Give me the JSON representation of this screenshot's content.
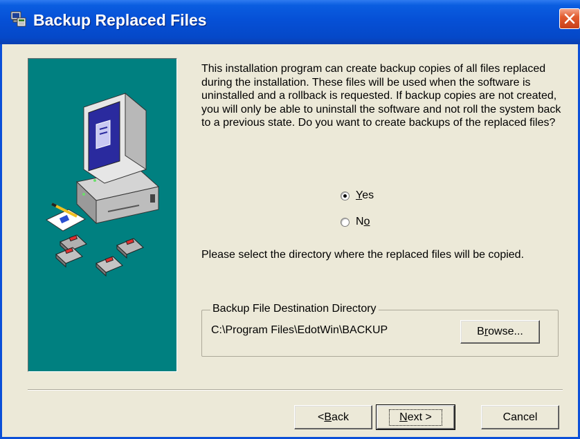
{
  "window": {
    "title": "Backup Replaced Files",
    "close_icon": "close-icon",
    "title_icon": "installer-icon",
    "accent_color": "#0a4fd8",
    "close_color": "#e25c30"
  },
  "side_panel": {
    "background": "#008080",
    "illustration": "computer-with-floppy-disks"
  },
  "intro_text": "This installation program can create backup copies of all files replaced during the installation. These files will be used when the software is uninstalled and a rollback is requested.  If backup copies are not created, you will only be able to uninstall the software and not roll the system back to a previous state. Do you want to create backups of the replaced files?",
  "options": {
    "yes": {
      "pre": "",
      "key": "Y",
      "post": "es",
      "checked": true
    },
    "no": {
      "pre": "N",
      "key": "o",
      "post": "",
      "checked": false
    }
  },
  "select_text": "Please select the directory where the replaced  files will be copied.",
  "destination": {
    "legend": "Backup File Destination Directory",
    "path": "C:\\Program Files\\EdotWin\\BACKUP",
    "browse": {
      "pre": "B",
      "key": "r",
      "post": "owse..."
    }
  },
  "footer": {
    "back": {
      "pre": "< ",
      "key": "B",
      "post": "ack"
    },
    "next": {
      "pre": "",
      "key": "N",
      "post": "ext >"
    },
    "cancel": "Cancel"
  }
}
